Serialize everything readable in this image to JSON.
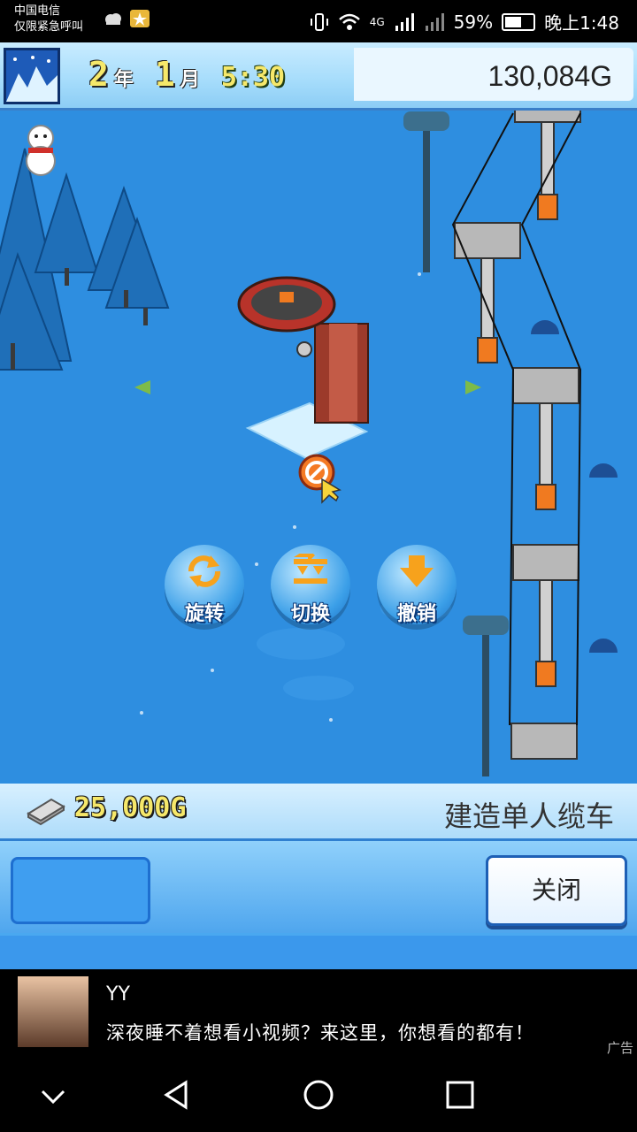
{
  "status_bar": {
    "carrier_line1": "中国电信",
    "carrier_line2": "仅限紧急呼叫",
    "network": "4G",
    "battery": "59%",
    "time": "晚上1:48"
  },
  "hud": {
    "year": "2",
    "year_unit": "年",
    "month": "1",
    "month_unit": "月",
    "clock": "5:30",
    "money": "130,084G"
  },
  "actions": {
    "rotate_label": "旋转",
    "switch_label": "切换",
    "undo_label": "撤销"
  },
  "build_panel": {
    "cost": "25,000G",
    "title": "建造单人缆车",
    "close_label": "关闭"
  },
  "ad": {
    "title": "YY",
    "text": "深夜睡不着想看小视频？来这里，你想看的都有！",
    "label": "广告"
  },
  "colors": {
    "snow_blue": "#2e8ee0",
    "panel_blue": "#4aa8f0",
    "gold_text": "#f6e86a"
  }
}
